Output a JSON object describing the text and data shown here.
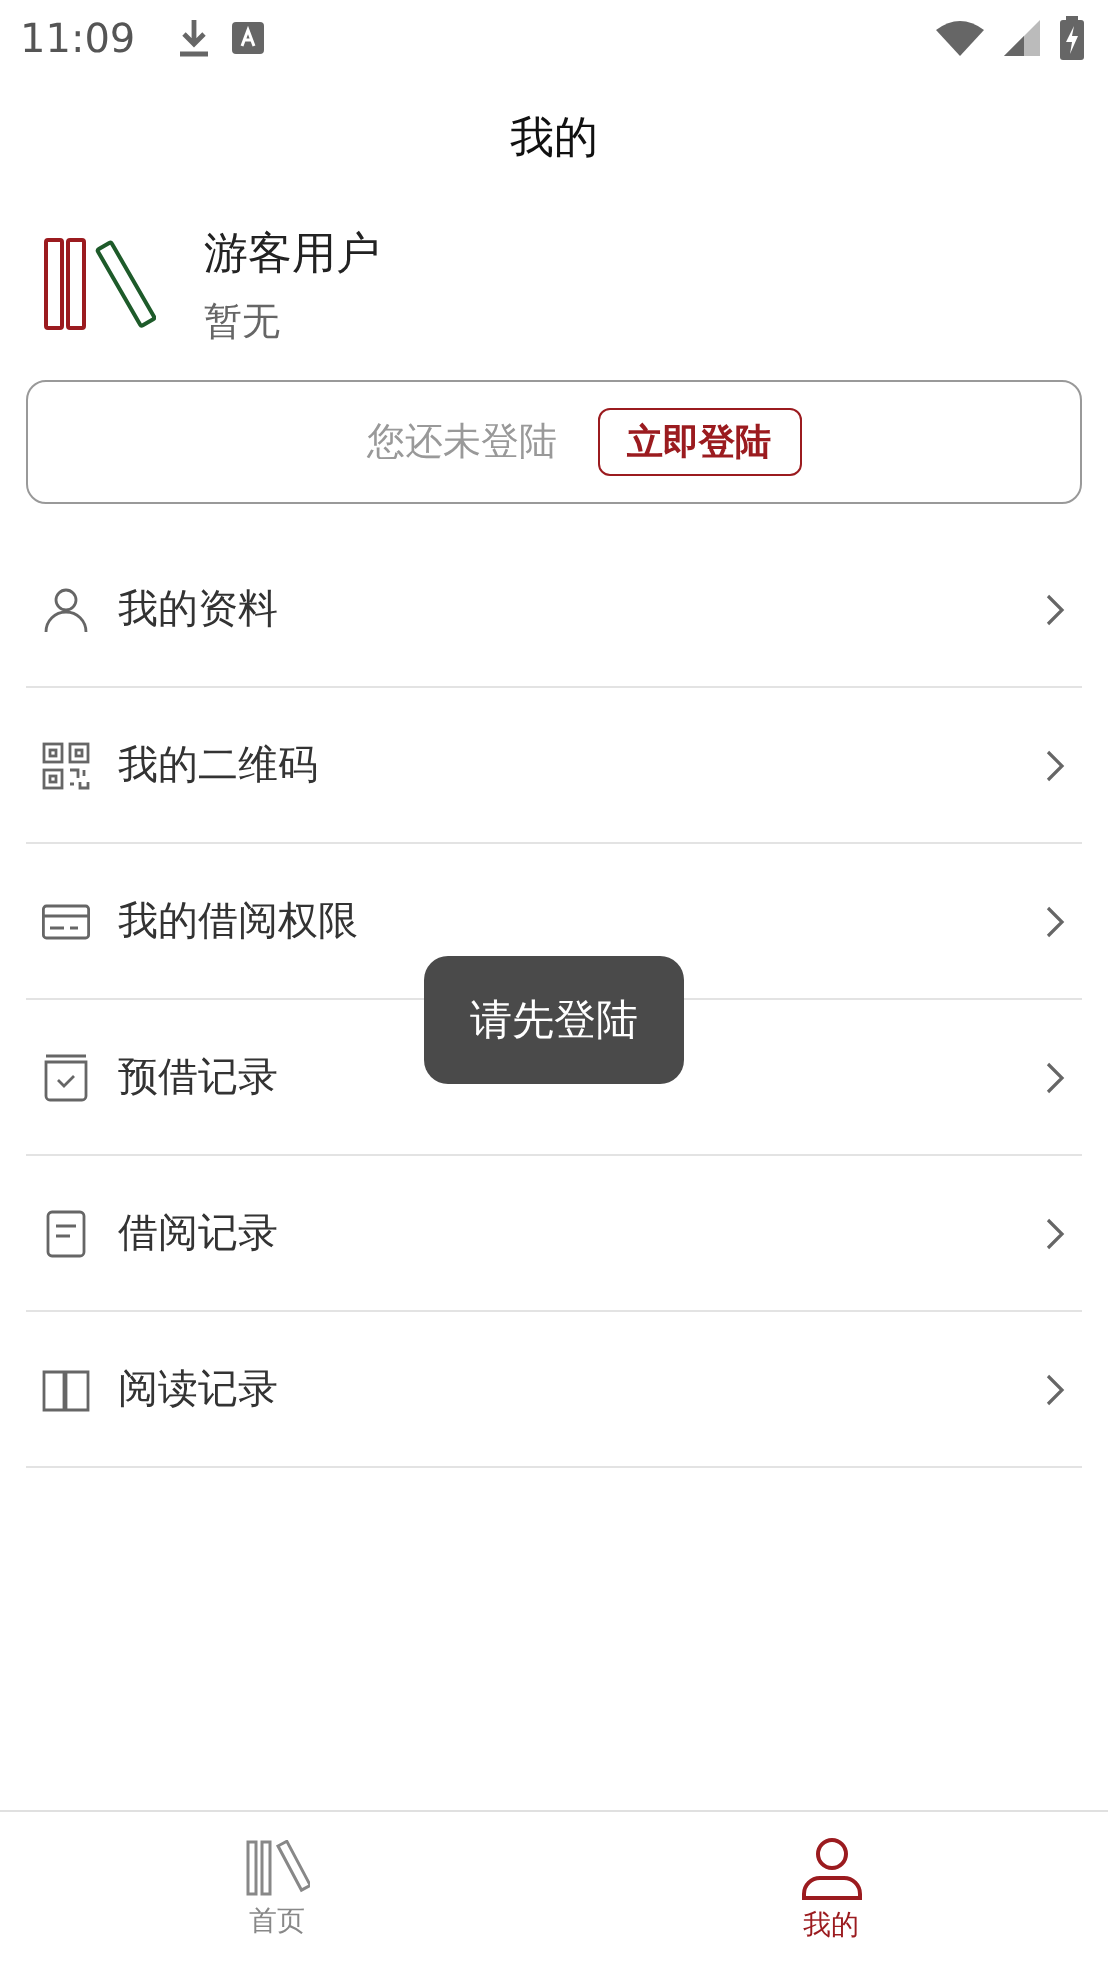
{
  "status_bar": {
    "time": "11:09"
  },
  "header": {
    "title": "我的"
  },
  "profile": {
    "name": "游客用户",
    "subtitle": "暂无"
  },
  "login_banner": {
    "message": "您还未登陆",
    "button": "立即登陆"
  },
  "menu": [
    {
      "kind": "person",
      "label": "我的资料"
    },
    {
      "kind": "qr",
      "label": "我的二维码"
    },
    {
      "kind": "card",
      "label": "我的借阅权限"
    },
    {
      "kind": "reserve",
      "label": "预借记录"
    },
    {
      "kind": "document",
      "label": "借阅记录"
    },
    {
      "kind": "book",
      "label": "阅读记录"
    }
  ],
  "toast": "请先登陆",
  "tab_bar": [
    {
      "kind": "books",
      "label": "首页",
      "selected": false
    },
    {
      "kind": "person",
      "label": "我的",
      "selected": true
    }
  ]
}
